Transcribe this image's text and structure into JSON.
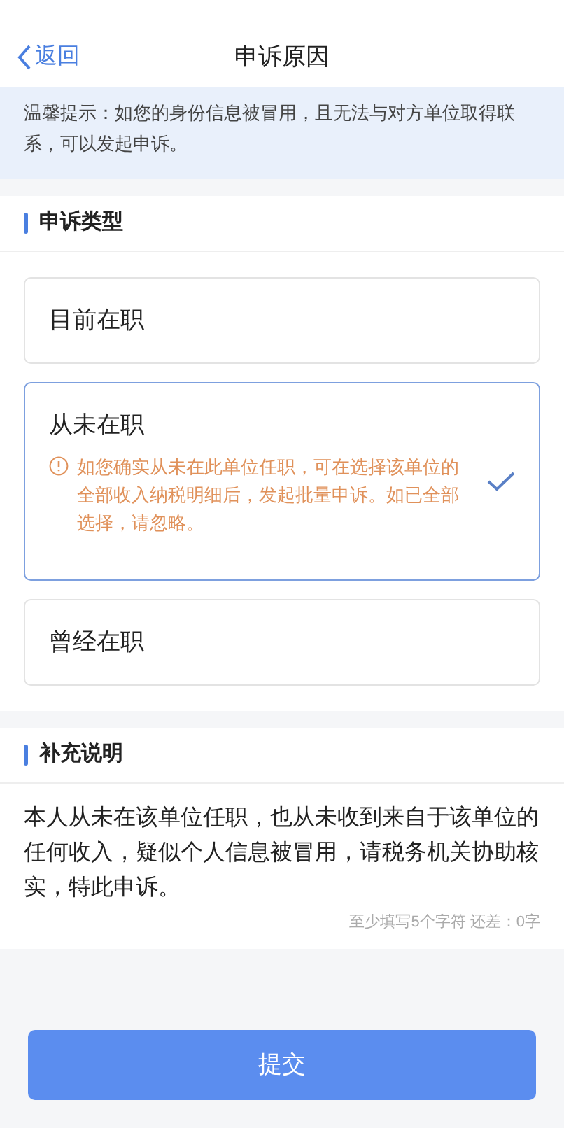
{
  "nav": {
    "back": "返回",
    "title": "申诉原因"
  },
  "tip": "温馨提示：如您的身份信息被冒用，且无法与对方单位取得联系，可以发起申诉。",
  "reason_section": {
    "title": "申诉类型",
    "options": [
      {
        "label": "目前在职",
        "selected": false
      },
      {
        "label": "从未在职",
        "selected": true,
        "note": "如您确实从未在此单位任职，可在选择该单位的全部收入纳税明细后，发起批量申诉。如已全部选择，请忽略。"
      },
      {
        "label": "曾经在职",
        "selected": false
      }
    ]
  },
  "description_section": {
    "title": "补充说明",
    "value": "本人从未在该单位任职，也从未收到来自于该单位的任何收入，疑似个人信息被冒用，请税务机关协助核实，特此申诉。",
    "counter": "至少填写5个字符 还差：0字"
  },
  "submit": "提交"
}
